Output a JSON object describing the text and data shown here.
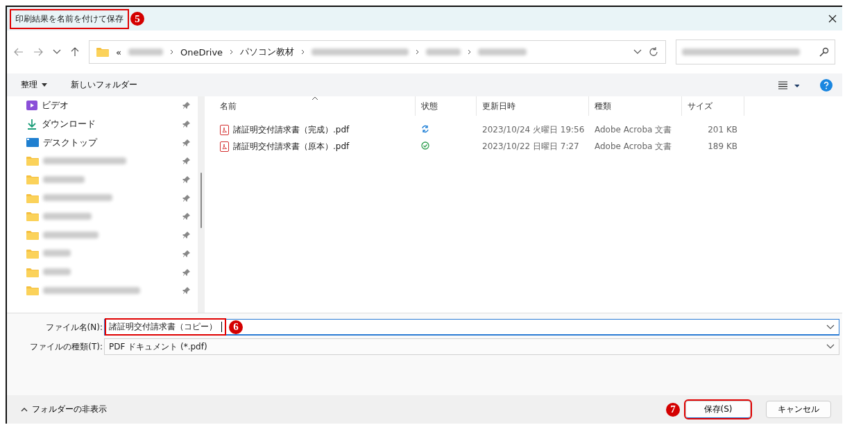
{
  "window": {
    "title": "印刷結果を名前を付けて保存",
    "title_highlighted": true,
    "title_callout": "5"
  },
  "address": {
    "prefix": "«",
    "segments": [
      {
        "kind": "blurred"
      },
      {
        "kind": "text",
        "label": "OneDrive"
      },
      {
        "kind": "text",
        "label": "パソコン教材"
      },
      {
        "kind": "blurred"
      },
      {
        "kind": "blurred"
      },
      {
        "kind": "blurred"
      }
    ]
  },
  "toolbar": {
    "organize": "整理",
    "new_folder": "新しいフォルダー"
  },
  "sidebar": {
    "items": [
      {
        "kind": "video",
        "label": "ビデオ"
      },
      {
        "kind": "download",
        "label": "ダウンロード"
      },
      {
        "kind": "desktop",
        "label": "デスクトップ"
      },
      {
        "kind": "folder"
      },
      {
        "kind": "folder"
      },
      {
        "kind": "folder"
      },
      {
        "kind": "folder"
      },
      {
        "kind": "folder"
      },
      {
        "kind": "folder"
      },
      {
        "kind": "folder"
      },
      {
        "kind": "folder"
      }
    ]
  },
  "table": {
    "columns": [
      "名前",
      "状態",
      "更新日時",
      "種類",
      "サイズ"
    ],
    "rows": [
      {
        "name": "諸証明交付請求書（完成）.pdf",
        "kind": "sync",
        "modified": "2023/10/24 火曜日 19:56",
        "type": "Adobe Acroba 文書",
        "size": "201 KB"
      },
      {
        "name": "諸証明交付請求書（原本）.pdf",
        "kind": "ok",
        "modified": "2023/10/22 日曜日 7:27",
        "type": "Adobe Acroba 文書",
        "size": "189 KB"
      }
    ]
  },
  "filename": {
    "label": "ファイル名(N):",
    "value": "諸証明交付請求書（コピー）",
    "highlighted": true,
    "callout": "6"
  },
  "filetype": {
    "label": "ファイルの種類(T):",
    "value": "PDF ドキュメント (*.pdf)"
  },
  "footer": {
    "hide_folders": "フォルダーの非表示",
    "save": "保存(S)",
    "save_highlighted": true,
    "save_callout": "7",
    "cancel": "キャンセル"
  }
}
